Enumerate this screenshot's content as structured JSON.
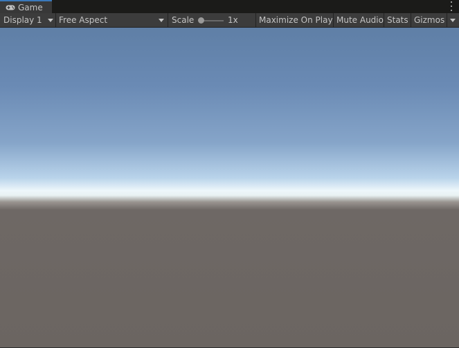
{
  "tab": {
    "title": "Game",
    "icon": "gamepad-icon"
  },
  "menu": {
    "icon": "kebab-menu-icon"
  },
  "toolbar": {
    "display": "Display 1",
    "aspect": "Free Aspect",
    "scale_label": "Scale",
    "scale_value": "1x",
    "scale_slider_level": 0.1,
    "maximize_on_play": "Maximize On Play",
    "mute_audio": "Mute Audio",
    "stats": "Stats",
    "gizmos": "Gizmos"
  },
  "colors": {
    "tab_accent": "#3a79bb",
    "toolbar_bg": "#3c3c3c",
    "sky_top": "#5f7fa6",
    "horizon": "#eef7fb",
    "ground": "#6b6561"
  }
}
